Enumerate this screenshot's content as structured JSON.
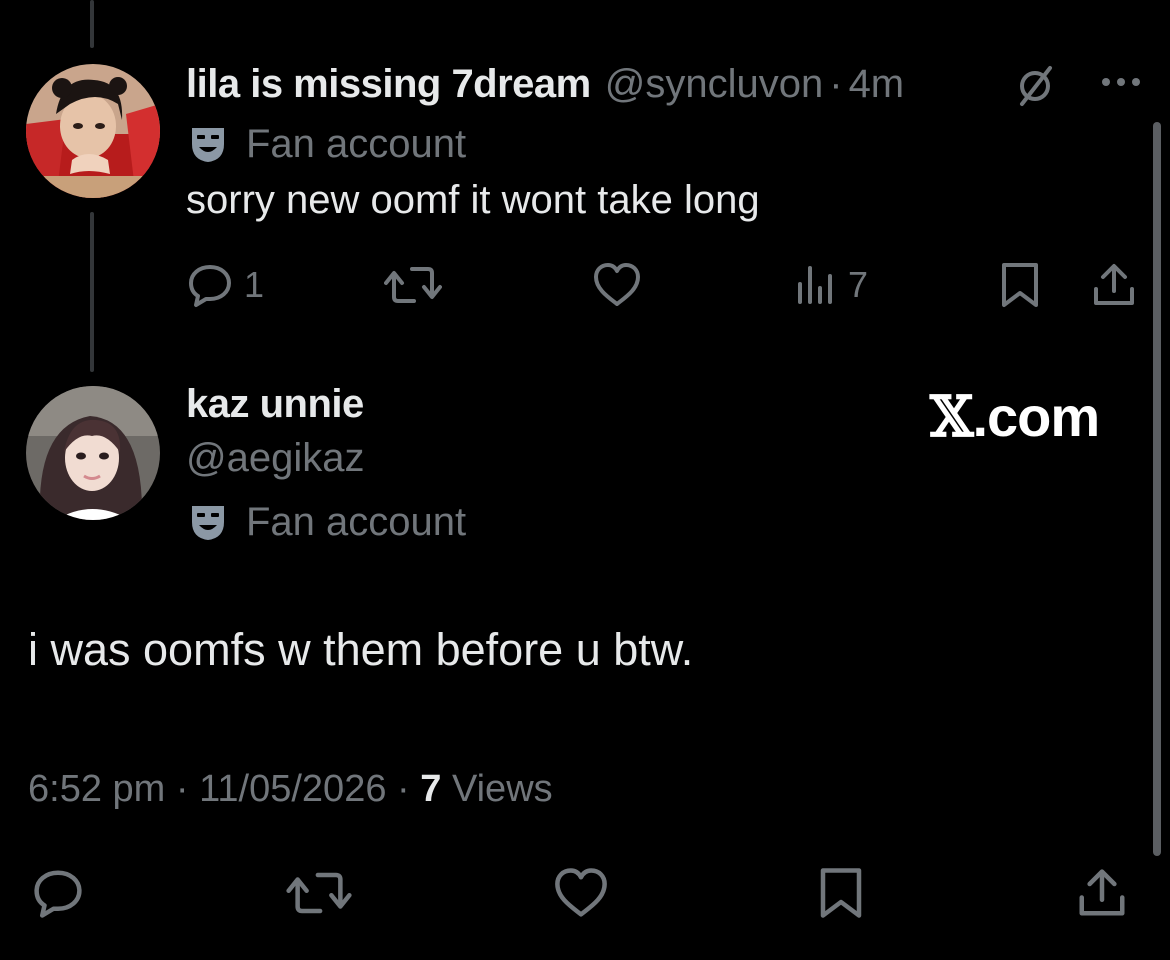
{
  "parent_tweet": {
    "display_name": "lila is missing 7dream",
    "handle": "@syncluvon",
    "separator": "·",
    "time": "4m",
    "label_text": "Fan account",
    "text": "sorry new oomf it wont take long",
    "reply_count": "1",
    "view_count": "7"
  },
  "main_tweet": {
    "display_name": "kaz unnie",
    "handle": "@aegikaz",
    "label_text": "Fan account",
    "text": "i was oomfs w them before u btw.",
    "timestamp": "6:52 pm",
    "separator": "·",
    "date": "11/05/2026",
    "views_count": "7",
    "views_label": "Views"
  },
  "watermark": {
    "x": "𝕏",
    "domain": ".com"
  },
  "icons": {
    "parent_header": [
      "grok-slash-icon",
      "more-icon"
    ],
    "parent_actions": [
      "reply-icon",
      "retweet-icon",
      "like-icon",
      "views-icon",
      "bookmark-icon",
      "share-icon"
    ],
    "main_actions": [
      "reply-icon",
      "retweet-icon",
      "like-icon",
      "bookmark-icon",
      "share-icon"
    ],
    "label_icon": "mask-icon"
  },
  "colors": {
    "background": "#000000",
    "primary_text": "#e7e9ea",
    "secondary_text": "#71767b",
    "thread_line": "#333639"
  }
}
